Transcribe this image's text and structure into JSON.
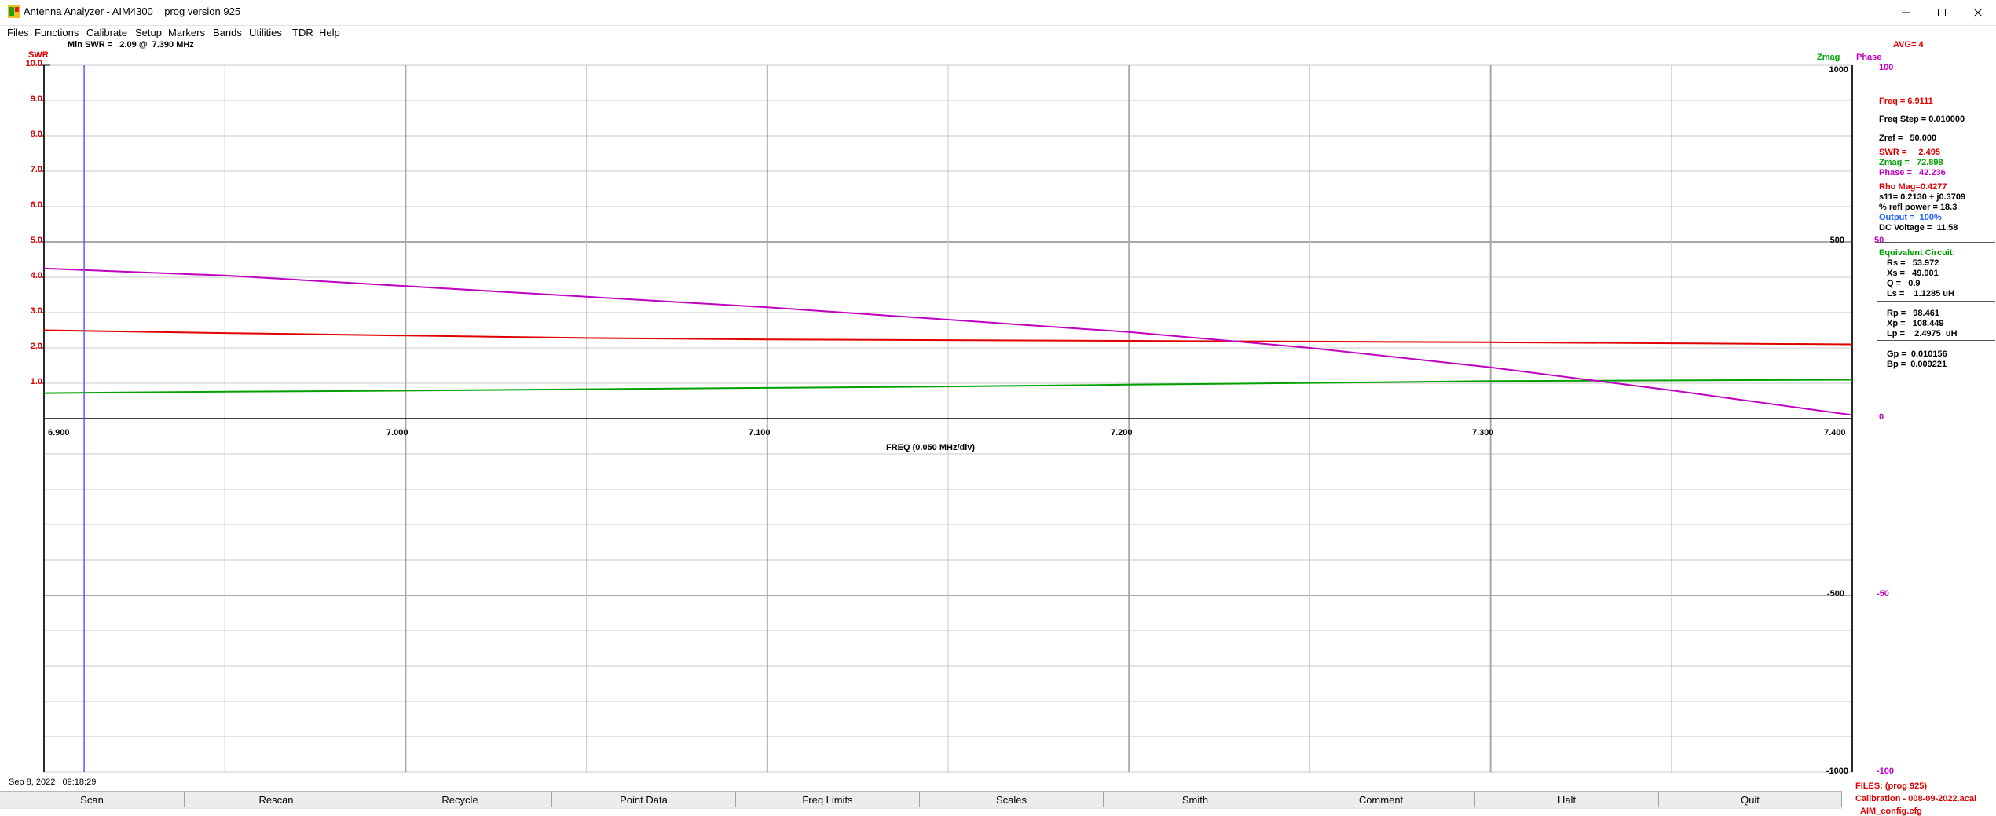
{
  "window": {
    "title": "Antenna Analyzer - AIM4300    prog version 925"
  },
  "menu": [
    "Files",
    "Functions",
    "Calibrate",
    "Setup",
    "Markers",
    "Bands",
    "Utilities",
    "TDR",
    "Help"
  ],
  "header": {
    "swr_label": "SWR",
    "min_swr": "Min SWR =   2.09 @  7.390 MHz",
    "zmag_label": "Zmag",
    "phase_label": "Phase",
    "avg": "AVG=  4"
  },
  "axes": {
    "swr_ticks": [
      "10.0",
      "9.0",
      "8.0",
      "7.0",
      "6.0",
      "5.0",
      "4.0",
      "3.0",
      "2.0",
      "1.0"
    ],
    "zmag_ticks": [
      "1000",
      "500",
      "0",
      "-500",
      "-1000"
    ],
    "phase_ticks": [
      "100",
      "50",
      "0",
      "-50",
      "-100"
    ],
    "freq_ticks": [
      "6.900",
      "7.000",
      "7.100",
      "7.200",
      "7.300",
      "7.400"
    ],
    "freq_label": "FREQ (0.050 MHz/div)"
  },
  "readout": {
    "freq": "Freq = 6.9111",
    "freq_step": "Freq Step = 0.010000",
    "zref": "Zref =   50.000",
    "swr": "SWR =     2.495",
    "zmag": "Zmag =   72.898",
    "phase": "Phase =   42.236",
    "rho": "Rho Mag=0.4277",
    "s11": "s11= 0.2130 + j0.3709",
    "refl_power": "% refl power = 18.3",
    "output": "Output =  100%",
    "dc_voltage": "DC Voltage =  11.58",
    "equiv_title": "Equivalent Circuit:",
    "rs": "Rs =   53.972",
    "xs": "Xs =   49.001",
    "q": "Q =   0.9",
    "ls": "Ls =    1.1285 uH",
    "rp": "Rp =   98.461",
    "xp": "Xp =   108.449",
    "lp": "Lp =    2.4975  uH",
    "gp": "Gp =  0.010156",
    "bp": "Bp =  0.009221"
  },
  "status": {
    "timestamp": "Sep 8, 2022   09:18:29",
    "files_title": "FILES:   (prog 925)",
    "calibration": "Calibration - 008-09-2022.acal",
    "config": "AIM_config.cfg"
  },
  "buttons": [
    "Scan",
    "Rescan",
    "Recycle",
    "Point Data",
    "Freq Limits",
    "Scales",
    "Smith",
    "Comment",
    "Halt",
    "Quit"
  ],
  "chart_data": {
    "type": "line",
    "x_range": [
      6.9,
      7.4
    ],
    "cursor_freq": 6.9111,
    "swr_range": [
      0,
      10
    ],
    "zmag_range": [
      -1000,
      1000
    ],
    "phase_range": [
      -100,
      100
    ],
    "series": [
      {
        "name": "SWR",
        "color": "#e00000",
        "x": [
          6.9,
          6.95,
          7.0,
          7.05,
          7.1,
          7.15,
          7.2,
          7.25,
          7.3,
          7.35,
          7.4
        ],
        "y": [
          2.5,
          2.42,
          2.35,
          2.28,
          2.24,
          2.22,
          2.2,
          2.18,
          2.16,
          2.13,
          2.1
        ]
      },
      {
        "name": "Zmag",
        "color": "#00a000",
        "x": [
          6.9,
          6.95,
          7.0,
          7.05,
          7.1,
          7.15,
          7.2,
          7.25,
          7.3,
          7.35,
          7.4
        ],
        "y": [
          72,
          76,
          79,
          83,
          87,
          91,
          96,
          101,
          106,
          108,
          110
        ]
      },
      {
        "name": "Phase",
        "color": "#c000c0",
        "x": [
          6.9,
          6.95,
          7.0,
          7.05,
          7.1,
          7.15,
          7.2,
          7.25,
          7.3,
          7.35,
          7.4
        ],
        "y": [
          42.5,
          40.5,
          37.5,
          34.5,
          31.5,
          28.0,
          24.5,
          20.0,
          14.5,
          8.0,
          1.0
        ]
      }
    ]
  },
  "colors": {
    "swr": "#e00000",
    "zmag": "#00a000",
    "phase": "#c000c0",
    "cursor": "#5a5aff",
    "grid": "#c8c8c8",
    "grid_major": "#a8a8a8"
  }
}
